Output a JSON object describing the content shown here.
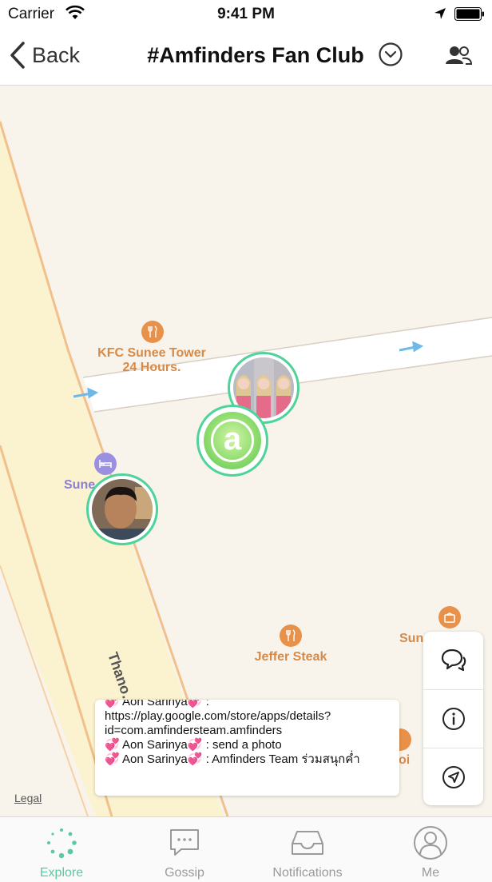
{
  "status_bar": {
    "carrier": "Carrier",
    "time": "9:41 PM"
  },
  "nav": {
    "back_label": "Back",
    "title": "#Amfinders Fan Club"
  },
  "map": {
    "pois": [
      {
        "name": "KFC Sunee Tower 24 Hours.",
        "line1": "KFC Sunee Tower",
        "line2": "24 Hours."
      },
      {
        "name": "Jeffer Steak",
        "label": "Jeffer Steak"
      },
      {
        "name": "Sunee shop partial",
        "label": "Sun"
      },
      {
        "name": "Hotel partial",
        "label": "Sune"
      },
      {
        "name": "restaurant partial",
        "label": "oi"
      }
    ],
    "street": "Thano…ku",
    "legal": "Legal"
  },
  "chat": {
    "messages": [
      {
        "sender": "Aon Sarinya",
        "text": " : https://play.google.com/store/apps/details?id=com.amfindersteam.amfinders"
      },
      {
        "sender": "Aon Sarinya",
        "text": " : send a photo"
      },
      {
        "sender": "Aon Sarinya",
        "text": " : Amfinders Team ร่วมสนุกค่ำ"
      }
    ]
  },
  "side_buttons": [
    "chat-bubbles-icon",
    "info-icon",
    "navigate-icon"
  ],
  "tabs": [
    {
      "label": "Explore",
      "active": true
    },
    {
      "label": "Gossip",
      "active": false
    },
    {
      "label": "Notifications",
      "active": false
    },
    {
      "label": "Me",
      "active": false
    }
  ],
  "colors": {
    "accent": "#5cc9a0",
    "marker_ring": "#4ed39a",
    "poi": "#e8914a",
    "road_edge": "#f2c08a"
  }
}
